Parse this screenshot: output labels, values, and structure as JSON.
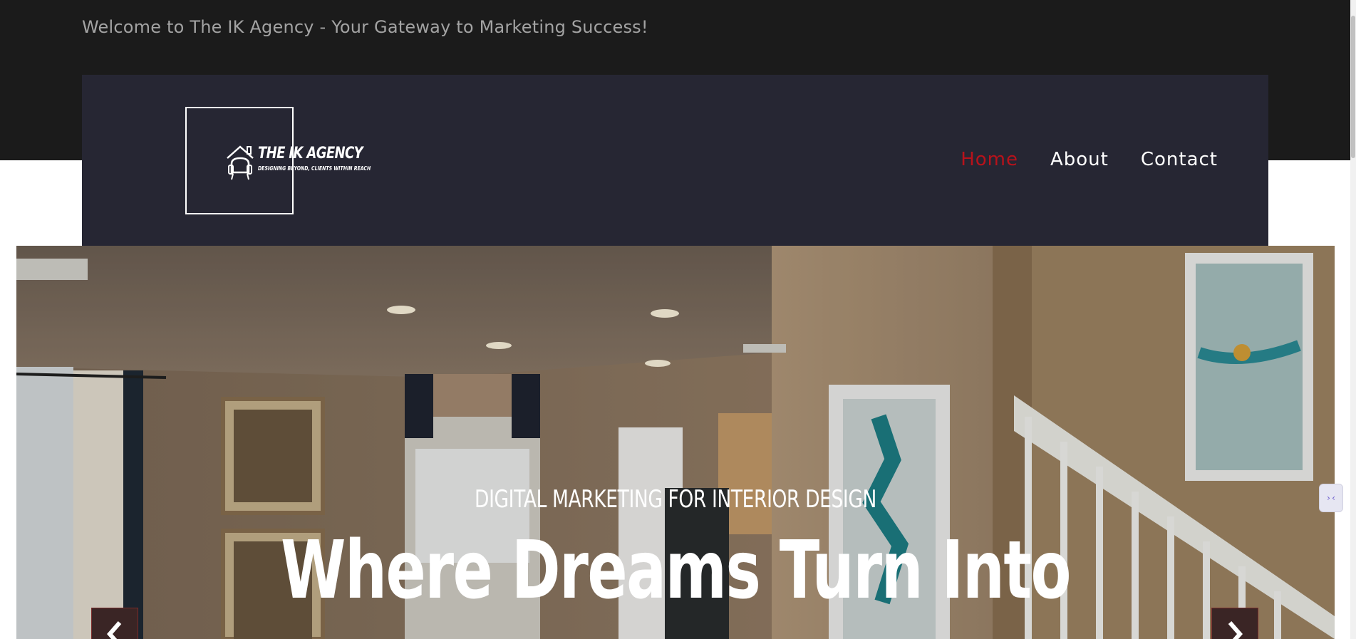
{
  "topbar": {
    "welcome_text": "Welcome to The IK Agency - Your Gateway to Marketing Success!"
  },
  "logo": {
    "title": "THE IK AGENCY",
    "tagline": "DESIGNING BEYOND, CLIENTS WITHIN REACH",
    "icon": "house-chair-icon"
  },
  "nav": {
    "items": [
      {
        "label": "Home",
        "active": true
      },
      {
        "label": "About",
        "active": false
      },
      {
        "label": "Contact",
        "active": false
      }
    ]
  },
  "hero": {
    "subtitle": "DIGITAL MARKETING FOR INTERIOR DESIGN",
    "title": "Where Dreams Turn Into",
    "prev_icon": "chevron-left-icon",
    "next_icon": "chevron-right-icon"
  },
  "side_widget": {
    "icon": "collapse-code-icon",
    "glyph": "›‹"
  },
  "colors": {
    "topbar": "#1b1b1b",
    "header": "#262633",
    "accent": "#b8121b",
    "text": "#ffffff"
  }
}
